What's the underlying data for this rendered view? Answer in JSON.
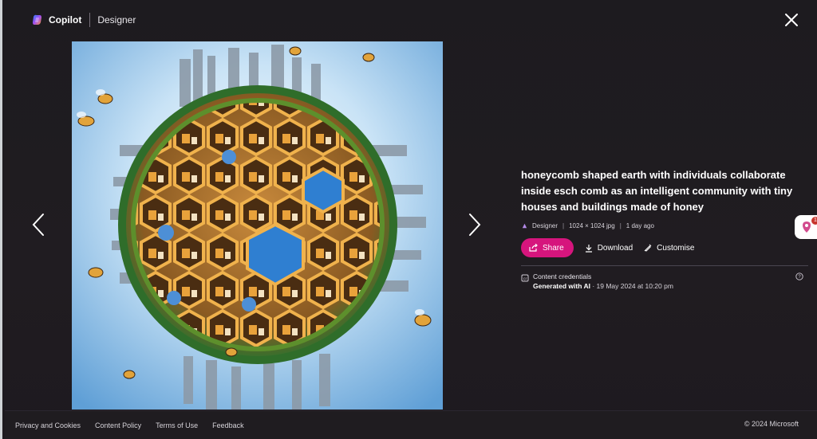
{
  "header": {
    "brand_name": "Copilot",
    "product_name": "Designer"
  },
  "image": {
    "alt": "honeycomb shaped earth with individuals collaborate inside esch comb as an intelligent community with tiny houses and buildings made of honey"
  },
  "info": {
    "prompt": "honeycomb shaped earth with individuals collaborate inside esch comb as an intelligent community with tiny houses and buildings made of honey",
    "source": "Designer",
    "dimensions": "1024 × 1024 jpg",
    "age": "1 day ago",
    "share_label": "Share",
    "download_label": "Download",
    "customise_label": "Customise",
    "credentials_title": "Content credentials",
    "generated_label": "Generated with AI",
    "generated_date": " · 19 May 2024 at 10:20 pm"
  },
  "side": {
    "badge_count": "1"
  },
  "footer": {
    "links": [
      "Privacy and Cookies",
      "Content Policy",
      "Terms of Use",
      "Feedback"
    ],
    "copyright": "© 2024 Microsoft"
  },
  "colors": {
    "accent": "#d6157d",
    "background": "#1e1a1f"
  },
  "icons": [
    "copilot-logo-icon",
    "close-icon",
    "chevron-left-icon",
    "chevron-right-icon",
    "share-icon",
    "download-icon",
    "customise-icon",
    "credentials-icon",
    "help-icon",
    "designer-icon"
  ]
}
